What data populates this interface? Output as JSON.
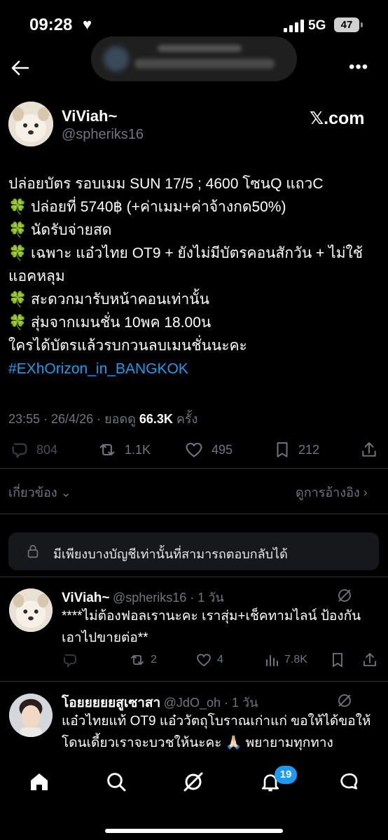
{
  "status_bar": {
    "time": "09:28",
    "network": "5G",
    "battery": "47"
  },
  "header": {
    "more_icon": "more-horizontal-icon",
    "back_icon": "back-arrow-icon"
  },
  "tweet": {
    "author_name": "ViViah~",
    "author_handle": "@spheriks16",
    "source_label": "𝕏.com",
    "lines": [
      "ปล่อยบัตร รอบเมม SUN 17/5 ; 4600 โซนQ แถวC",
      "🍀 ปล่อยที่ 5740฿ (+ค่าเมม+ค่าจ้างกด50%)",
      "🍀 นัดรับจ่ายสด",
      "🍀 เฉพาะ แอ๋วไทย OT9 + ยังไม่มีบัตรคอนสักวัน + ไม่ใช้แอคหลุม",
      "🍀 สะดวกมารับหน้าคอนเท่านั้น",
      "🍀 สุ่มจากเมนชั่น 10พค 18.00น",
      " ใครได้บัตรแล้วรบกวนลบเมนชั่นนะคะ"
    ],
    "hashtag": "#EXhOrizon_in_BANGKOK",
    "timestamp": "23:55 · 26/4/26 · ยอดดู ",
    "views": "66.3K",
    "views_suffix": " ครั้ง",
    "replies": "804",
    "reposts": "1.1K",
    "likes": "495",
    "bookmarks": "212"
  },
  "related": {
    "label": "เกี่ยวข้อง",
    "quotes_label": "ดูการอ้างอิง"
  },
  "reply_notice": "มีเพียงบางบัญชีเท่านั้นที่สามารถตอบกลับได้",
  "replies": [
    {
      "name": "ViViah~",
      "handle": "@spheriks16 · 1 วัน",
      "text": "****ไม่ต้องฟอลเรานะคะ เราสุ่ม+เช็คทามไลน์ ป้องกันเอาไปขายต่อ**",
      "reposts": "2",
      "likes": "4",
      "views": "7.8K"
    },
    {
      "name": "โอยยยยยสูเซาสา",
      "handle": "@JdO_oh · 1 วัน",
      "text": "แอ๋วไทยแท้ OT9 แอ๋ววัตถุโบราณเก่าแก่ ขอให้ได้ขอให้โดนเดี้ยวเราจะบวชให้นะคะ 🙏🏻 พยายามทุกทาง"
    }
  ],
  "tabbar": {
    "notifications_badge": "19"
  },
  "colors": {
    "background": "#000000",
    "accent": "#1d9bf0",
    "muted": "#71767b"
  }
}
